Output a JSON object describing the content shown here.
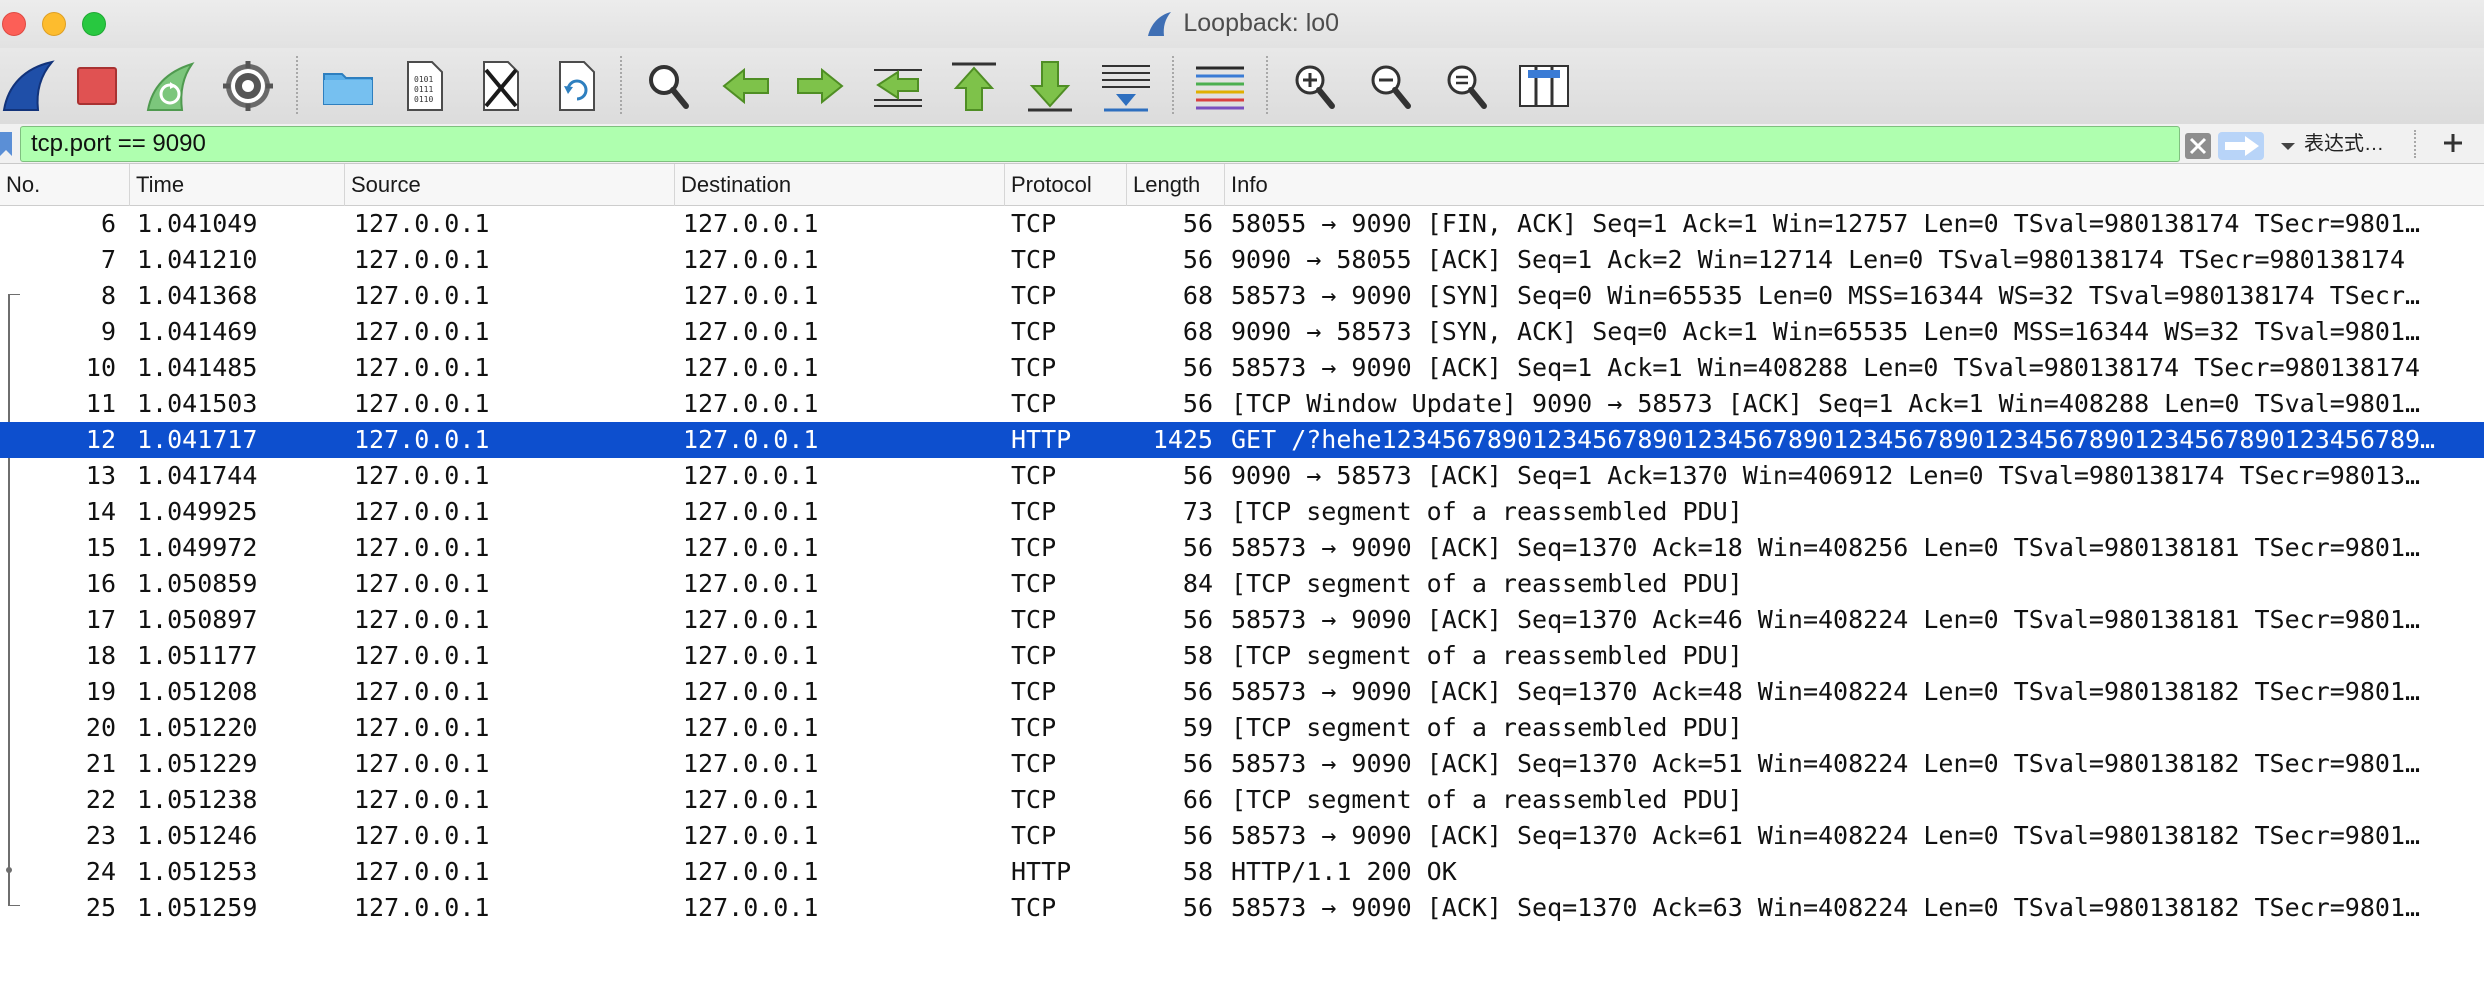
{
  "window": {
    "title": "Loopback: lo0",
    "controls": [
      "close",
      "minimize",
      "zoom"
    ]
  },
  "toolbar": {
    "buttons": [
      {
        "name": "start-capture",
        "icon": "shark-fin-icon"
      },
      {
        "name": "stop-capture",
        "icon": "stop-icon"
      },
      {
        "name": "restart-capture",
        "icon": "restart-fin-icon"
      },
      {
        "name": "capture-options",
        "icon": "gear-icon"
      },
      {
        "name": "open-file",
        "icon": "folder-icon"
      },
      {
        "name": "save-file",
        "icon": "binary-file-icon"
      },
      {
        "name": "close-file",
        "icon": "close-file-icon"
      },
      {
        "name": "reload-file",
        "icon": "reload-file-icon"
      },
      {
        "name": "find-packet",
        "icon": "magnifier-icon"
      },
      {
        "name": "go-back",
        "icon": "arrow-left-icon"
      },
      {
        "name": "go-forward",
        "icon": "arrow-right-icon"
      },
      {
        "name": "go-to-packet",
        "icon": "goto-packet-icon"
      },
      {
        "name": "go-first",
        "icon": "arrow-up-icon"
      },
      {
        "name": "go-last",
        "icon": "arrow-down-icon"
      },
      {
        "name": "auto-scroll",
        "icon": "autoscroll-icon"
      },
      {
        "name": "colorize",
        "icon": "colorize-lines-icon"
      },
      {
        "name": "zoom-in",
        "icon": "zoom-in-icon"
      },
      {
        "name": "zoom-out",
        "icon": "zoom-out-icon"
      },
      {
        "name": "normal-size",
        "icon": "zoom-reset-icon"
      },
      {
        "name": "resize-columns",
        "icon": "resize-columns-icon"
      }
    ]
  },
  "filter": {
    "value": "tcp.port == 9090",
    "expression_label": "表达式…",
    "clear_icon": "clear-x-icon",
    "apply_icon": "apply-arrow-icon",
    "history_icon": "chevron-down-icon",
    "add_icon": "plus-icon",
    "background": "#afffaf"
  },
  "packet_list": {
    "columns": [
      "No.",
      "Time",
      "Source",
      "Destination",
      "Protocol",
      "Length",
      "Info"
    ],
    "selected_color": "#0d4fce",
    "rows": [
      {
        "no": "6",
        "time": "1.041049",
        "source": "127.0.0.1",
        "destination": "127.0.0.1",
        "protocol": "TCP",
        "length": "56",
        "info": "58055 → 9090 [FIN, ACK] Seq=1 Ack=1 Win=12757 Len=0 TSval=980138174 TSecr=9801…",
        "selected": false
      },
      {
        "no": "7",
        "time": "1.041210",
        "source": "127.0.0.1",
        "destination": "127.0.0.1",
        "protocol": "TCP",
        "length": "56",
        "info": "9090 → 58055 [ACK] Seq=1 Ack=2 Win=12714 Len=0 TSval=980138174 TSecr=980138174",
        "selected": false
      },
      {
        "no": "8",
        "time": "1.041368",
        "source": "127.0.0.1",
        "destination": "127.0.0.1",
        "protocol": "TCP",
        "length": "68",
        "info": "58573 → 9090 [SYN] Seq=0 Win=65535 Len=0 MSS=16344 WS=32 TSval=980138174 TSecr…",
        "selected": false
      },
      {
        "no": "9",
        "time": "1.041469",
        "source": "127.0.0.1",
        "destination": "127.0.0.1",
        "protocol": "TCP",
        "length": "68",
        "info": "9090 → 58573 [SYN, ACK] Seq=0 Ack=1 Win=65535 Len=0 MSS=16344 WS=32 TSval=9801…",
        "selected": false
      },
      {
        "no": "10",
        "time": "1.041485",
        "source": "127.0.0.1",
        "destination": "127.0.0.1",
        "protocol": "TCP",
        "length": "56",
        "info": "58573 → 9090 [ACK] Seq=1 Ack=1 Win=408288 Len=0 TSval=980138174 TSecr=980138174",
        "selected": false
      },
      {
        "no": "11",
        "time": "1.041503",
        "source": "127.0.0.1",
        "destination": "127.0.0.1",
        "protocol": "TCP",
        "length": "56",
        "info": "[TCP Window Update] 9090 → 58573 [ACK] Seq=1 Ack=1 Win=408288 Len=0 TSval=9801…",
        "selected": false
      },
      {
        "no": "12",
        "time": "1.041717",
        "source": "127.0.0.1",
        "destination": "127.0.0.1",
        "protocol": "HTTP",
        "length": "1425",
        "info": "GET /?hehe123456789012345678901234567890123456789012345678901234567890123456789…",
        "selected": true
      },
      {
        "no": "13",
        "time": "1.041744",
        "source": "127.0.0.1",
        "destination": "127.0.0.1",
        "protocol": "TCP",
        "length": "56",
        "info": "9090 → 58573 [ACK] Seq=1 Ack=1370 Win=406912 Len=0 TSval=980138174 TSecr=98013…",
        "selected": false
      },
      {
        "no": "14",
        "time": "1.049925",
        "source": "127.0.0.1",
        "destination": "127.0.0.1",
        "protocol": "TCP",
        "length": "73",
        "info": "[TCP segment of a reassembled PDU]",
        "selected": false
      },
      {
        "no": "15",
        "time": "1.049972",
        "source": "127.0.0.1",
        "destination": "127.0.0.1",
        "protocol": "TCP",
        "length": "56",
        "info": "58573 → 9090 [ACK] Seq=1370 Ack=18 Win=408256 Len=0 TSval=980138181 TSecr=9801…",
        "selected": false
      },
      {
        "no": "16",
        "time": "1.050859",
        "source": "127.0.0.1",
        "destination": "127.0.0.1",
        "protocol": "TCP",
        "length": "84",
        "info": "[TCP segment of a reassembled PDU]",
        "selected": false
      },
      {
        "no": "17",
        "time": "1.050897",
        "source": "127.0.0.1",
        "destination": "127.0.0.1",
        "protocol": "TCP",
        "length": "56",
        "info": "58573 → 9090 [ACK] Seq=1370 Ack=46 Win=408224 Len=0 TSval=980138181 TSecr=9801…",
        "selected": false
      },
      {
        "no": "18",
        "time": "1.051177",
        "source": "127.0.0.1",
        "destination": "127.0.0.1",
        "protocol": "TCP",
        "length": "58",
        "info": "[TCP segment of a reassembled PDU]",
        "selected": false
      },
      {
        "no": "19",
        "time": "1.051208",
        "source": "127.0.0.1",
        "destination": "127.0.0.1",
        "protocol": "TCP",
        "length": "56",
        "info": "58573 → 9090 [ACK] Seq=1370 Ack=48 Win=408224 Len=0 TSval=980138182 TSecr=9801…",
        "selected": false
      },
      {
        "no": "20",
        "time": "1.051220",
        "source": "127.0.0.1",
        "destination": "127.0.0.1",
        "protocol": "TCP",
        "length": "59",
        "info": "[TCP segment of a reassembled PDU]",
        "selected": false
      },
      {
        "no": "21",
        "time": "1.051229",
        "source": "127.0.0.1",
        "destination": "127.0.0.1",
        "protocol": "TCP",
        "length": "56",
        "info": "58573 → 9090 [ACK] Seq=1370 Ack=51 Win=408224 Len=0 TSval=980138182 TSecr=9801…",
        "selected": false
      },
      {
        "no": "22",
        "time": "1.051238",
        "source": "127.0.0.1",
        "destination": "127.0.0.1",
        "protocol": "TCP",
        "length": "66",
        "info": "[TCP segment of a reassembled PDU]",
        "selected": false
      },
      {
        "no": "23",
        "time": "1.051246",
        "source": "127.0.0.1",
        "destination": "127.0.0.1",
        "protocol": "TCP",
        "length": "56",
        "info": "58573 → 9090 [ACK] Seq=1370 Ack=61 Win=408224 Len=0 TSval=980138182 TSecr=9801…",
        "selected": false
      },
      {
        "no": "24",
        "time": "1.051253",
        "source": "127.0.0.1",
        "destination": "127.0.0.1",
        "protocol": "HTTP",
        "length": "58",
        "info": "HTTP/1.1 200 OK",
        "selected": false
      },
      {
        "no": "25",
        "time": "1.051259",
        "source": "127.0.0.1",
        "destination": "127.0.0.1",
        "protocol": "TCP",
        "length": "56",
        "info": "58573 → 9090 [ACK] Seq=1370 Ack=63 Win=408224 Len=0 TSval=980138182 TSecr=9801…",
        "selected": false
      }
    ]
  }
}
